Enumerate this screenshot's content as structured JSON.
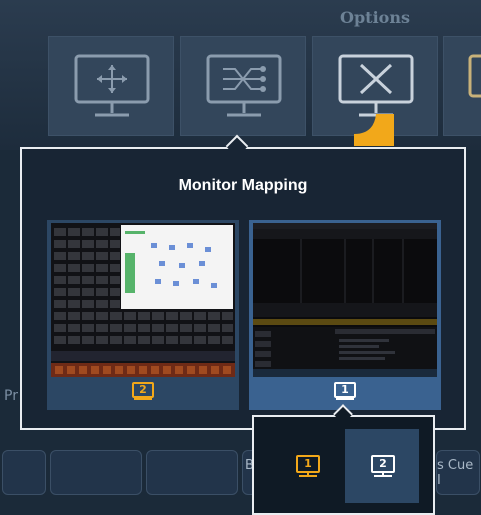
{
  "options": {
    "label": "Options"
  },
  "background": {
    "left_text": "Pr",
    "cue_text": "s Cue I",
    "b_text": "B"
  },
  "popup": {
    "title": "Monitor Mapping",
    "monitors": [
      {
        "number": "2"
      },
      {
        "number": "1"
      }
    ]
  },
  "selector": {
    "options": [
      {
        "number": "1"
      },
      {
        "number": "2"
      }
    ]
  },
  "colors": {
    "accent": "#f2a81a",
    "card_bg": "#2c4764",
    "popup_border": "#e9edf1"
  }
}
